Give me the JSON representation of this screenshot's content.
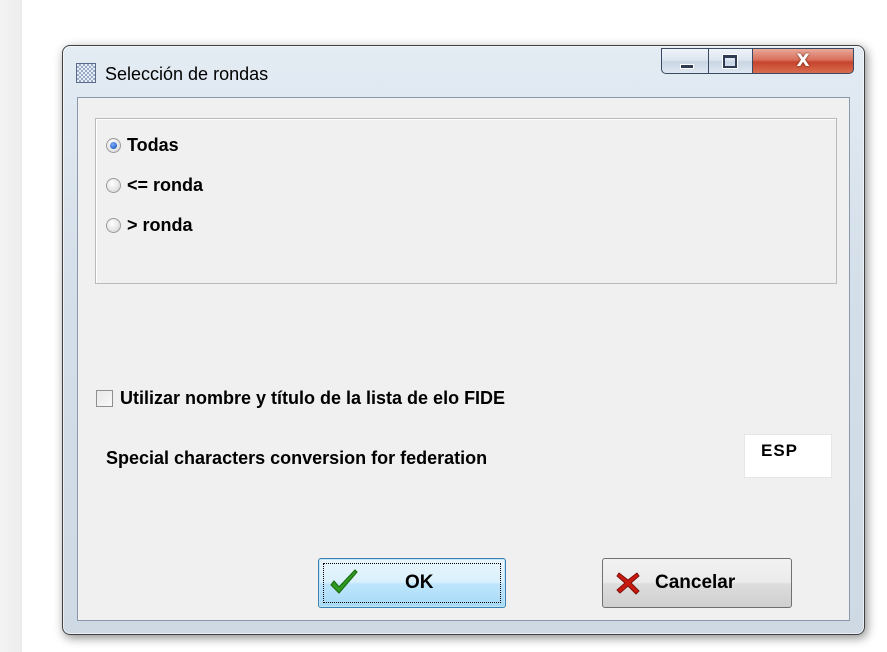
{
  "window": {
    "title": "Selección de rondas",
    "minimize_icon": "minimize-icon",
    "maximize_icon": "maximize-icon",
    "close_icon": "close-icon",
    "close_glyph": "X"
  },
  "rounds": {
    "options": [
      {
        "label": "Todas",
        "checked": true
      },
      {
        "label": "<= ronda",
        "checked": false
      },
      {
        "label": "> ronda",
        "checked": false
      }
    ]
  },
  "fide": {
    "label": "Utilizar nombre y título de la lista de elo FIDE",
    "checked": false
  },
  "conversion": {
    "label": "Special characters conversion for federation",
    "value": "ESP"
  },
  "buttons": {
    "ok_label": "OK",
    "ok_icon": "checkmark-icon",
    "cancel_label": "Cancelar",
    "cancel_icon": "x-icon"
  },
  "colors": {
    "ok_check": "#2e9a1f",
    "cancel_x": "#c81a0f",
    "close_button": "#c7442c"
  }
}
